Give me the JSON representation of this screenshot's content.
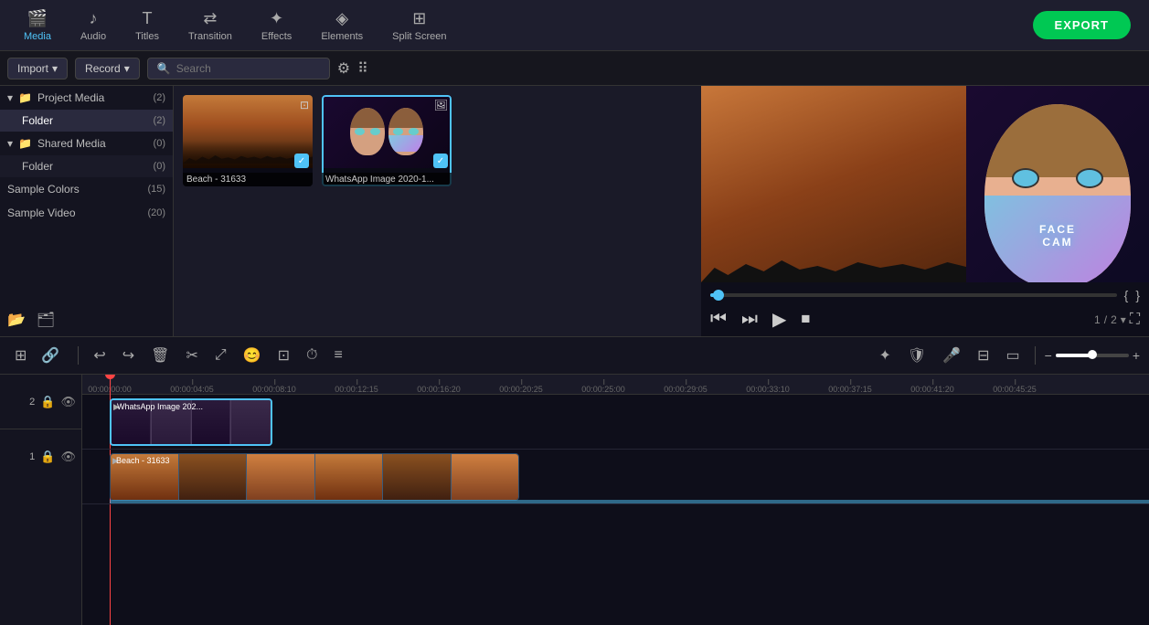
{
  "topToolbar": {
    "tabs": [
      {
        "id": "media",
        "label": "Media",
        "icon": "🎬",
        "active": true
      },
      {
        "id": "audio",
        "label": "Audio",
        "icon": "🎵",
        "active": false
      },
      {
        "id": "titles",
        "label": "Titles",
        "icon": "T",
        "active": false
      },
      {
        "id": "transition",
        "label": "Transition",
        "icon": "⇄",
        "active": false
      },
      {
        "id": "effects",
        "label": "Effects",
        "icon": "✨",
        "active": false
      },
      {
        "id": "elements",
        "label": "Elements",
        "icon": "◈",
        "active": false
      },
      {
        "id": "splitscreen",
        "label": "Split Screen",
        "icon": "⊞",
        "active": false
      }
    ],
    "exportLabel": "EXPORT"
  },
  "secondToolbar": {
    "importLabel": "Import",
    "recordLabel": "Record",
    "searchPlaceholder": "Search"
  },
  "sidebar": {
    "sections": [
      {
        "id": "project-media",
        "label": "Project Media",
        "count": 2,
        "items": [
          {
            "id": "folder-proj",
            "label": "Folder",
            "count": 2,
            "active": true
          }
        ]
      },
      {
        "id": "shared-media",
        "label": "Shared Media",
        "count": 0,
        "items": [
          {
            "id": "folder-shared",
            "label": "Folder",
            "count": 0,
            "active": false
          }
        ]
      }
    ],
    "standaloneItems": [
      {
        "id": "sample-colors",
        "label": "Sample Colors",
        "count": 15
      },
      {
        "id": "sample-video",
        "label": "Sample Video",
        "count": 20
      }
    ]
  },
  "mediaItems": [
    {
      "id": "beach",
      "label": "Beach - 31633",
      "type": "video",
      "selected": false,
      "checked": true
    },
    {
      "id": "whatsapp",
      "label": "WhatsApp Image 2020-1...",
      "type": "image",
      "selected": true,
      "checked": true
    }
  ],
  "playback": {
    "currentPage": "1",
    "totalPages": "2",
    "pageSeparator": "/"
  },
  "editToolbar": {
    "buttons": [
      "↩",
      "↪",
      "🗑",
      "✂",
      "⤢",
      "😊",
      "⊡",
      "⏱",
      "≡"
    ]
  },
  "timeline": {
    "timeMarks": [
      "00:00:00:00",
      "00:00:04:05",
      "00:00:08:10",
      "00:00:12:15",
      "00:00:16:20",
      "00:00:20:25",
      "00:00:25:00",
      "00:00:29:05",
      "00:00:33:10",
      "00:00:37:15",
      "00:00:41:20",
      "00:00:45:25"
    ],
    "tracks": [
      {
        "id": "track2",
        "type": "video2",
        "clip": "WhatsApp Image 202..."
      },
      {
        "id": "track1",
        "type": "video1",
        "clip": "Beach - 31633"
      }
    ]
  }
}
